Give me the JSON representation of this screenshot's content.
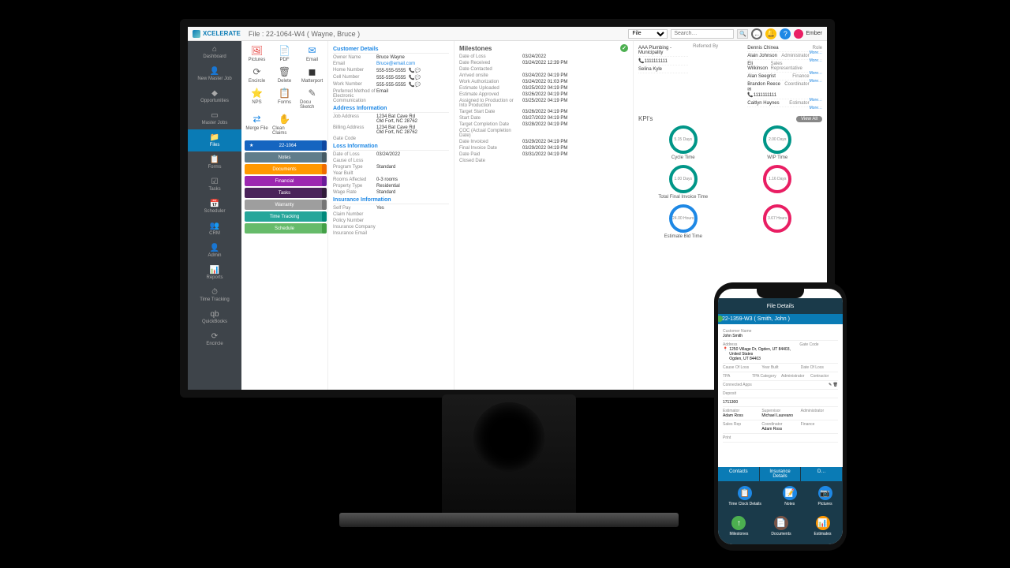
{
  "app": {
    "name": "XCELERATE",
    "file_title": "File : 22-1064-W4 ( Wayne, Bruce )",
    "search_placeholder": "Search…",
    "file_dropdown": "File",
    "user": "Ember"
  },
  "sidebar": [
    {
      "label": "Dashboard",
      "icon": "⌂"
    },
    {
      "label": "New Master Job",
      "icon": "👤"
    },
    {
      "label": "Opportunities",
      "icon": "◆"
    },
    {
      "label": "Master Jobs",
      "icon": "▭"
    },
    {
      "label": "Files",
      "icon": "📁",
      "active": true
    },
    {
      "label": "Forms",
      "icon": "📋"
    },
    {
      "label": "Tasks",
      "icon": "☑"
    },
    {
      "label": "Scheduler",
      "icon": "📅"
    },
    {
      "label": "CRM",
      "icon": "👥"
    },
    {
      "label": "Admin",
      "icon": "👤"
    },
    {
      "label": "Reports",
      "icon": "📊"
    },
    {
      "label": "Time Tracking",
      "icon": "⏱"
    },
    {
      "label": "QuickBooks",
      "icon": "qb"
    },
    {
      "label": "Encircle",
      "icon": "⟳"
    }
  ],
  "tools": [
    {
      "label": "Pictures",
      "icon": "🖼",
      "color": "#e53935"
    },
    {
      "label": "PDF",
      "icon": "📄",
      "color": "#e53935"
    },
    {
      "label": "Email",
      "icon": "✉",
      "color": "#1e88e5"
    },
    {
      "label": "Encircle",
      "icon": "⟳",
      "color": "#666"
    },
    {
      "label": "Delete",
      "icon": "🗑",
      "color": "#666"
    },
    {
      "label": "Matterport",
      "icon": "◼",
      "color": "#333"
    },
    {
      "label": "NPS",
      "icon": "⭐",
      "color": "#1e88e5"
    },
    {
      "label": "Forms",
      "icon": "📋",
      "color": "#666"
    },
    {
      "label": "Docu Sketch",
      "icon": "✎",
      "color": "#666"
    },
    {
      "label": "Merge File",
      "icon": "⇄",
      "color": "#1e88e5"
    },
    {
      "label": "Clean Claims",
      "icon": "✋",
      "color": "#666"
    }
  ],
  "tabs": [
    {
      "label": "22-1064",
      "bg": "#1565c0",
      "ext": "#0d47a1",
      "icon": "★"
    },
    {
      "label": "Notes",
      "bg": "#607d8b",
      "ext": "#455a64"
    },
    {
      "label": "Documents",
      "bg": "#ff9800",
      "ext": "#ef6c00"
    },
    {
      "label": "Financial",
      "bg": "#9c27b0",
      "ext": "#6a1b9a"
    },
    {
      "label": "Tasks",
      "bg": "#4a235a",
      "ext": "#311b3a"
    },
    {
      "label": "Warranty",
      "bg": "#9e9e9e",
      "ext": "#757575"
    },
    {
      "label": "Time Tracking",
      "bg": "#26a69a",
      "ext": "#00897b"
    },
    {
      "label": "Schedule",
      "bg": "#66bb6a",
      "ext": "#43a047"
    }
  ],
  "customer": {
    "hdr": "Customer Details",
    "owner_name_l": "Owner Name",
    "owner_name": "Bruce Wayne",
    "email_l": "Email",
    "email": "Bruce@email.com",
    "home_l": "Home Number",
    "home": "555-555-5555",
    "cell_l": "Cell Number",
    "cell": "555-555-5555",
    "work_l": "Work Number",
    "work": "555-555-5555",
    "pref_l": "Preferred Method of Electronic Communication",
    "pref": "Email"
  },
  "address": {
    "hdr": "Address Information",
    "job_l": "Job Address",
    "job": "1234 Bat Cave Rd\nOld Fort, NC 28762",
    "bill_l": "Billing Address",
    "bill": "1234 Bat Cave Rd\nOld Fort, NC 28762",
    "gate_l": "Gate Code"
  },
  "loss": {
    "hdr": "Loss Information",
    "dol_l": "Date of Loss",
    "dol": "03/24/2022",
    "col_l": "Cause of Loss",
    "prog_l": "Program Type",
    "prog": "Standard",
    "year_l": "Year Built",
    "rooms_l": "Rooms Affected",
    "rooms": "0-3 rooms",
    "ptype_l": "Property Type",
    "ptype": "Residential",
    "wage_l": "Wage Rate",
    "wage": "Standard"
  },
  "insurance": {
    "hdr": "Insurance Information",
    "self_l": "Self Pay",
    "self": "Yes",
    "claim_l": "Claim Number",
    "policy_l": "Policy Number",
    "co_l": "Insurance Company",
    "iemail_l": "Insurance Email"
  },
  "milestones": {
    "hdr": "Milestones",
    "rows": [
      {
        "l": "Date of Loss",
        "v": "03/24/2022"
      },
      {
        "l": "Date Received",
        "v": "03/24/2022 12:39 PM"
      },
      {
        "l": "Date Contacted",
        "v": ""
      },
      {
        "l": "Arrived onsite",
        "v": "03/24/2022 04:19 PM"
      },
      {
        "l": "Work Authorization",
        "v": "03/24/2022 01:03 PM"
      },
      {
        "l": "Estimate Uploaded",
        "v": "03/25/2022 04:19 PM"
      },
      {
        "l": "Estimate Approved",
        "v": "03/26/2022 04:19 PM"
      },
      {
        "l": "Assigned to Production or Into Production",
        "v": "03/25/2022 04:19 PM"
      },
      {
        "l": "Target Start Date",
        "v": "03/26/2022 04:19 PM"
      },
      {
        "l": "Start Date",
        "v": "03/27/2022 04:19 PM"
      },
      {
        "l": "Target Completion Date",
        "v": "03/28/2022 04:19 PM"
      },
      {
        "l": "COC (Actual Completion Date)",
        "v": ""
      },
      {
        "l": "Date Invoiced",
        "v": "03/29/2022 04:19 PM"
      },
      {
        "l": "Final Invoice Date",
        "v": "03/29/2022 04:19 PM"
      },
      {
        "l": "Date Paid",
        "v": "03/31/2022 04:19 PM"
      },
      {
        "l": "Closed Date",
        "v": ""
      }
    ]
  },
  "top_cols": {
    "c1_hdr": "",
    "c1_rows": [
      "AAA Plumbing - Municipality",
      "📞1111111111",
      "Selina  Kyle"
    ],
    "c2_hdr": "Referred By",
    "c3_hdr": "",
    "c3_rows": [
      {
        "name": "Dennis Chinea",
        "role": "Role"
      },
      {
        "name": "Alain Johnson",
        "role": "Administrator"
      },
      {
        "name": "Eli Wilkinson",
        "role": "Sales Representative"
      },
      {
        "name": "Alan Seegrist",
        "role": "Finance"
      },
      {
        "name": "Brandon Reece ✉",
        "role": "Coordinator",
        "phone": "📞1111111111"
      },
      {
        "name": "Caitlyn  Haynes",
        "role": "Estimator"
      }
    ],
    "more": "More…"
  },
  "kpis": {
    "hdr": "KPI's",
    "view_all": "View All",
    "items": [
      {
        "label": "Cycle Time",
        "val": "5.15 Days",
        "color": "#009688"
      },
      {
        "label": "WIP Time",
        "val": "2.00 Days",
        "color": "#009688"
      },
      {
        "label": "Total Final Invoice Time",
        "val": "1.00 Days",
        "color": "#009688"
      },
      {
        "label": "",
        "val": "1.16 Days",
        "color": "#e91e63"
      },
      {
        "label": "Estimate Bid Time",
        "val": "24.00 Hours",
        "color": "#1e88e5"
      },
      {
        "label": "",
        "val": "3.67 Hours",
        "color": "#e91e63"
      }
    ]
  },
  "phone": {
    "hdr": "File Details",
    "file": "22-1359-W3 ( Smith, John )",
    "cust_l": "Customer Name",
    "cust": "John Smith",
    "addr_l": "Address",
    "addr": "1250 Village Dr, Ogden, UT 84403, United States",
    "addr2": "Ogden, UT 84403",
    "gate_l": "Gate Code",
    "cols1": [
      "Cause Of Loss",
      "Year Built",
      "Date Of Loss"
    ],
    "cols2": [
      "TPA",
      "TPA Category",
      "Administrator",
      "Contractor"
    ],
    "apps_l": "Connected Apps",
    "deposit_l": "Deposit",
    "deposit": "1711300",
    "staff": [
      {
        "l": "Estimator",
        "v": "Adam Ross"
      },
      {
        "l": "Supervisor",
        "v": "Michael Laureano"
      },
      {
        "l": "Administrator",
        "v": ""
      },
      {
        "l": "Sales Rep",
        "v": ""
      },
      {
        "l": "Coordinator",
        "v": "Adam Ross"
      },
      {
        "l": "Finance",
        "v": ""
      }
    ],
    "print_l": "Print",
    "tabs": [
      "Contacts",
      "Insurance Details",
      "D…"
    ],
    "actions1": [
      {
        "label": "Time Clock Details",
        "icon": "📋",
        "color": "#1e88e5"
      },
      {
        "label": "Notes",
        "icon": "📝",
        "color": "#1e88e5"
      },
      {
        "label": "Pictures",
        "icon": "📷",
        "color": "#1e88e5"
      }
    ],
    "actions2": [
      {
        "label": "Milestones",
        "icon": "↑",
        "color": "#4caf50"
      },
      {
        "label": "Documents",
        "icon": "📄",
        "color": "#795548"
      },
      {
        "label": "Estimates",
        "icon": "📊",
        "color": "#ff9800"
      }
    ]
  }
}
